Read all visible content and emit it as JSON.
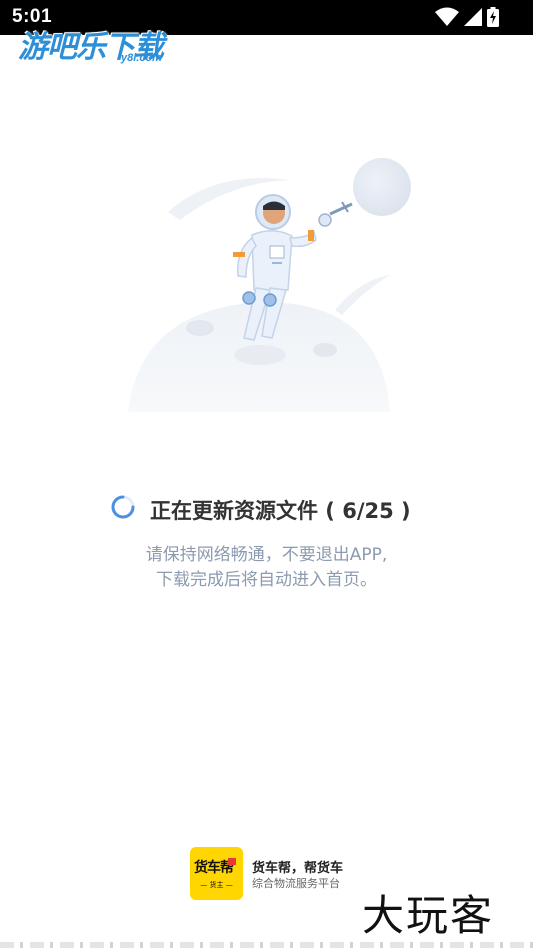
{
  "status_bar": {
    "time": "5:01",
    "icons": [
      "wifi-icon",
      "signal-icon",
      "battery-charging-icon"
    ]
  },
  "watermark_top": {
    "main": "游吧乐下载",
    "sub": "y8l.com",
    "color": "#2d8fd8"
  },
  "loading": {
    "message": "正在更新资源文件 ( 6/25 )",
    "progress": {
      "current": 6,
      "total": 25
    },
    "hint_line1": "请保持网络畅通，不要退出APP,",
    "hint_line2": "下载完成后将自动进入首页。",
    "spinner_color": "#4a90e2"
  },
  "brand": {
    "logo_text": "货车帮",
    "logo_subtext": "— 货主 —",
    "name": "货车帮，帮货车",
    "slogan": "综合物流服务平台",
    "logo_color": "#ffd600"
  },
  "watermark_bottom": {
    "text": "大玩客"
  }
}
